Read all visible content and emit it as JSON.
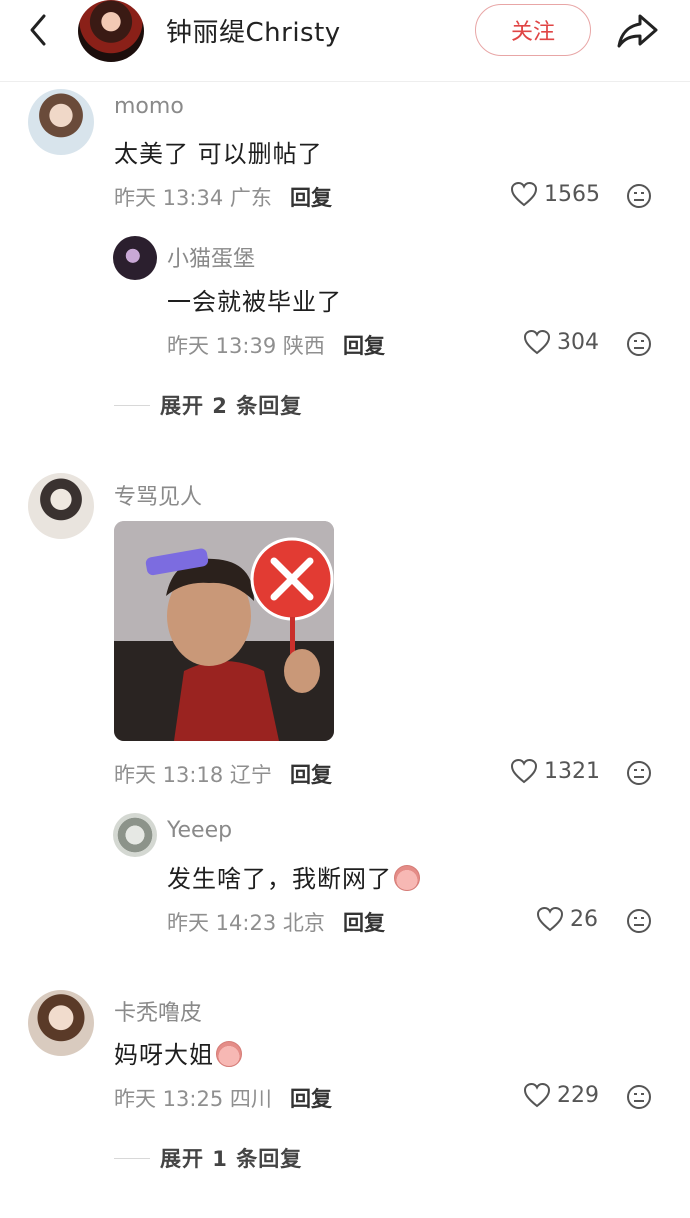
{
  "header": {
    "title": "钟丽缇Christy",
    "follow_label": "关注"
  },
  "comments": [
    {
      "username": "momo",
      "content": "太美了 可以删帖了",
      "meta": "昨天 13:34 广东",
      "reply_label": "回复",
      "likes": "1565",
      "replies": [
        {
          "username": "小猫蛋堡",
          "content": "一会就被毕业了",
          "meta": "昨天 13:39 陕西",
          "reply_label": "回复",
          "likes": "304"
        }
      ],
      "expand_label": "展开 2 条回复"
    },
    {
      "username": "专骂见人",
      "content": "",
      "has_image": true,
      "meta": "昨天 13:18 辽宁",
      "reply_label": "回复",
      "likes": "1321",
      "replies": [
        {
          "username": "Yeeep",
          "content": "发生啥了，我断网了",
          "meta": "昨天 14:23 北京",
          "reply_label": "回复",
          "likes": "26"
        }
      ]
    },
    {
      "username": "卡秃噜皮",
      "content": "妈呀大姐",
      "meta": "昨天 13:25 四川",
      "reply_label": "回复",
      "likes": "229",
      "expand_label": "展开 1 条回复"
    }
  ],
  "icons": {
    "back": "chevron-left-icon",
    "share": "share-arrow-icon",
    "like": "heart-outline-icon",
    "dislike": "neutral-face-icon"
  },
  "colors": {
    "accent": "#e04545",
    "follow_border": "#e8a6a6",
    "muted_text": "#8f8f8f"
  }
}
